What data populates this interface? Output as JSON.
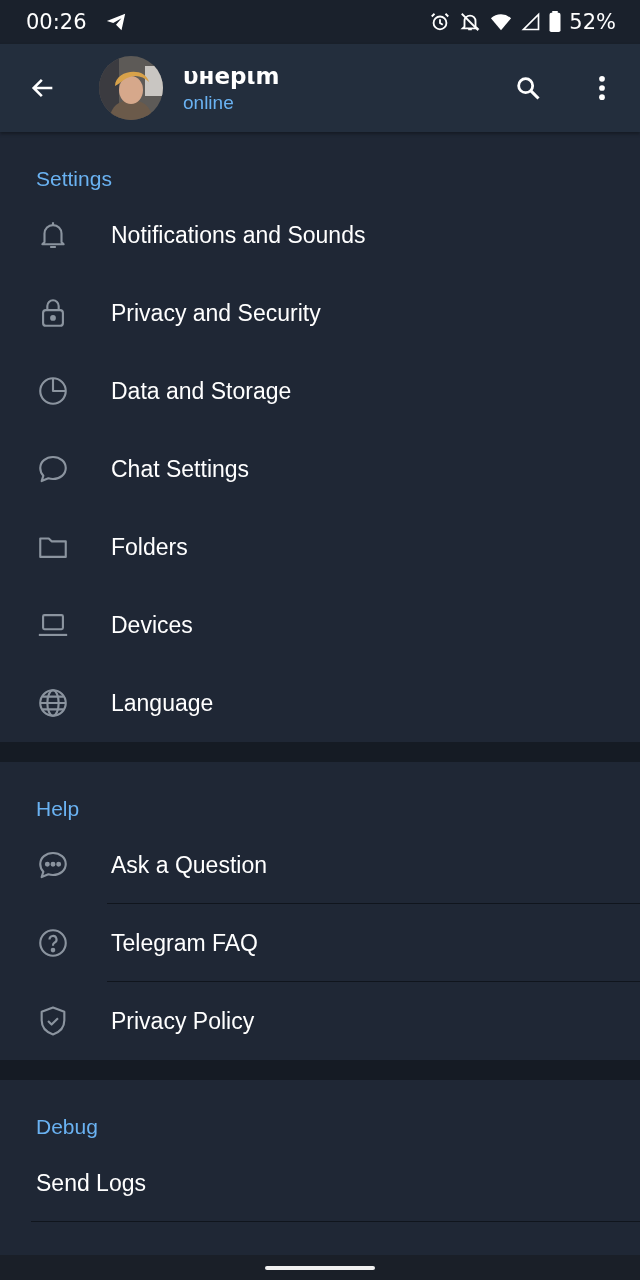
{
  "status_bar": {
    "time": "00:26",
    "battery": "52%"
  },
  "header": {
    "name": "υнepιm",
    "status": "online"
  },
  "sections": [
    {
      "title": "Settings",
      "items": [
        {
          "label": "Notifications and Sounds",
          "kind": "bell",
          "divider": false
        },
        {
          "label": "Privacy and Security",
          "kind": "lock",
          "divider": false
        },
        {
          "label": "Data and Storage",
          "kind": "pie",
          "divider": false
        },
        {
          "label": "Chat Settings",
          "kind": "chat",
          "divider": false
        },
        {
          "label": "Folders",
          "kind": "folder",
          "divider": false
        },
        {
          "label": "Devices",
          "kind": "laptop",
          "divider": false
        },
        {
          "label": "Language",
          "kind": "globe",
          "divider": false
        }
      ]
    },
    {
      "title": "Help",
      "items": [
        {
          "label": "Ask a Question",
          "kind": "chat-dots",
          "divider": true
        },
        {
          "label": "Telegram FAQ",
          "kind": "question",
          "divider": true
        },
        {
          "label": "Privacy Policy",
          "kind": "shield",
          "divider": false
        }
      ]
    },
    {
      "title": "Debug",
      "items": [
        {
          "label": "Send Logs",
          "kind": "plain",
          "divider": true
        }
      ]
    }
  ]
}
